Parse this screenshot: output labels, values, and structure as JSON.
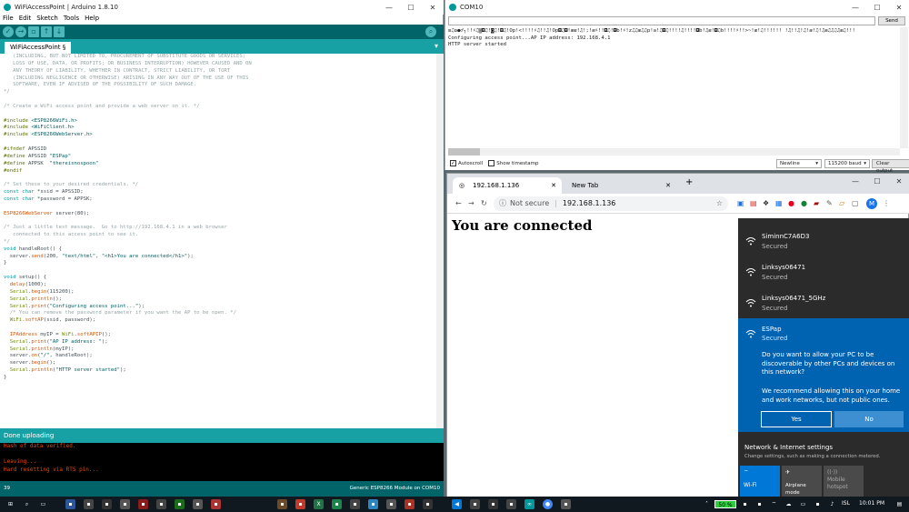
{
  "arduino": {
    "title": "WiFiAccessPoint | Arduino 1.8.10",
    "menu": [
      "File",
      "Edit",
      "Sketch",
      "Tools",
      "Help"
    ],
    "tab": "WiFiAccessPoint §",
    "status": "Done uploading",
    "console_lines": [
      "Hash of data verified.",
      "",
      "Leaving...",
      "Hard resetting via RTS pin..."
    ],
    "line_no": "39",
    "board": "Generic ESP8266 Module on COM10"
  },
  "com": {
    "title": "COM10",
    "send_label": "Send",
    "output": [
      "≡♫ʘ●♂┐!!♯♫▒◘♫!◙♫!◘♫!Ǒp!<!!!!♯♫!!♫!Ǒp◘♫◘!ææ!♫!;!æ♯!!◘♫!◘b!♯!z♫♫æ♫♫p!a!♫◘♫!!!!♫!!!!◘b!♫æ!◘♫b!!!!♯!!>~!æ!♫!!!!!! !♫!!♫!♫!æ!♫!♫æ♫♫♫♫æ♫!!!",
      "Configuring access point...AP IP address: 192.168.4.1",
      "HTTP server started"
    ],
    "autoscroll": "Autoscroll",
    "timestamp": "Show timestamp",
    "line_ending": "Newline",
    "baud": "115200 baud",
    "clear": "Clear output"
  },
  "chrome": {
    "tab1": "192.168.1.136",
    "tab2": "New Tab",
    "not_secure": "Not secure",
    "url": "192.168.1.136",
    "heading": "You are connected",
    "profile": "M"
  },
  "network": {
    "items": [
      {
        "name": "SiminnC7A6D3",
        "status": "Secured"
      },
      {
        "name": "Linksys06471",
        "status": "Secured"
      },
      {
        "name": "Linksys06471_5GHz",
        "status": "Secured"
      }
    ],
    "selected": {
      "name": "ESPap",
      "status": "Secured"
    },
    "prompt": "Do you want to allow your PC to be discoverable by other PCs and devices on this network?",
    "recommend": "We recommend allowing this on your home and work networks, but not public ones.",
    "yes": "Yes",
    "no": "No",
    "settings_title": "Network & Internet settings",
    "settings_sub": "Change settings, such as making a connection metered.",
    "tiles": [
      "Wi-Fi",
      "Airplane mode",
      "Mobile hotspot"
    ]
  },
  "taskbar": {
    "battery": "50 %",
    "lang": "ISL",
    "time": "10:01 PM"
  }
}
